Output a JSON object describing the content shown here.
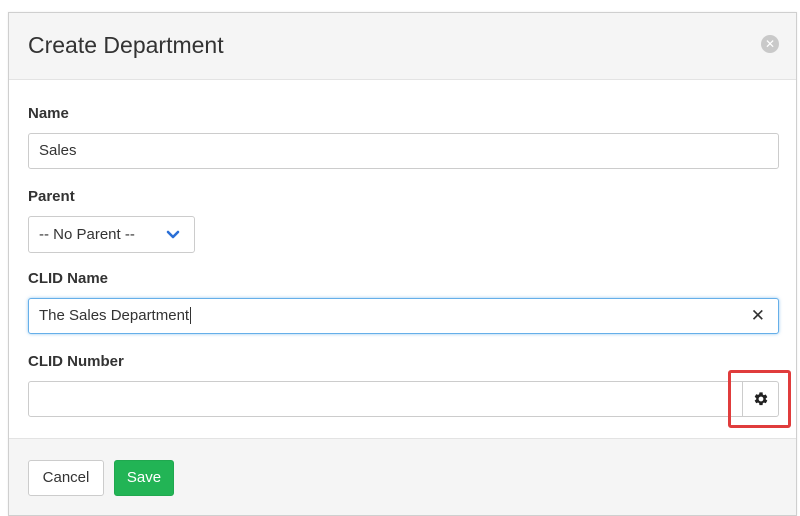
{
  "modal": {
    "title": "Create Department",
    "close_icon": "close-circle-icon"
  },
  "form": {
    "name": {
      "label": "Name",
      "value": "Sales"
    },
    "parent": {
      "label": "Parent",
      "selected": "-- No Parent --"
    },
    "clid_name": {
      "label": "CLID Name",
      "value": "The Sales Department",
      "clear_icon": "close-icon"
    },
    "clid_number": {
      "label": "CLID Number",
      "value": "",
      "addon_icon": "gear-icon"
    }
  },
  "footer": {
    "cancel_label": "Cancel",
    "save_label": "Save"
  },
  "colors": {
    "save_button": "#22b455",
    "highlight": "#e03c3c",
    "chevron": "#2a6fd6",
    "focus_border": "#66afe9"
  }
}
